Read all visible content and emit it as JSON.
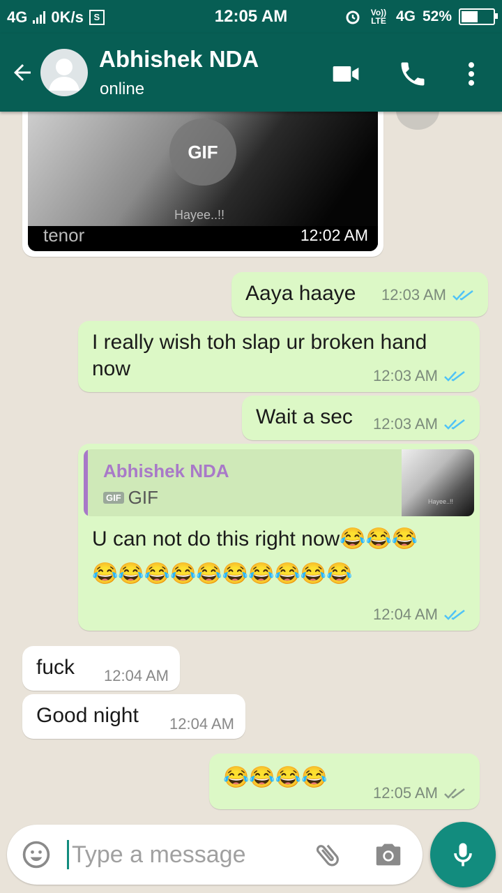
{
  "status_bar": {
    "network": "4G",
    "speed": "0K/s",
    "sd_icon": "S",
    "time": "12:05 AM",
    "volte": "Vo)) LTE",
    "network2": "4G",
    "battery": "52%",
    "battery_level": 0.52
  },
  "header": {
    "contact_name": "Abhishek NDA",
    "status": "online"
  },
  "messages": {
    "gif": {
      "badge": "GIF",
      "brand": "tenor",
      "caption": "Hayee..!!",
      "time": "12:02 AM"
    },
    "m1": {
      "text": "Aaya haaye",
      "time": "12:03 AM"
    },
    "m2": {
      "text": "I really wish toh slap ur broken hand now",
      "time": "12:03 AM"
    },
    "m3": {
      "text": "Wait a sec",
      "time": "12:03 AM"
    },
    "m4": {
      "quote_name": "Abhishek NDA",
      "quote_badge": "GIF",
      "quote_type": "GIF",
      "quote_thumb_caption": "Hayee..!!",
      "text": "U can not do this right now😂😂😂",
      "emojis": "😂😂😂😂😂😂😂😂😂😂",
      "time": "12:04 AM"
    },
    "m5": {
      "text": "fuck",
      "time": "12:04 AM"
    },
    "m6": {
      "text": "Good night",
      "time": "12:04 AM"
    },
    "m7": {
      "text": "😂😂😂😂",
      "time": "12:05 AM"
    }
  },
  "input": {
    "placeholder": "Type a message"
  },
  "colors": {
    "header": "#075e54",
    "outgoing": "#dcf8c6",
    "incoming": "#ffffff",
    "accent": "#128c7e",
    "read_ticks": "#4fc3f7"
  }
}
